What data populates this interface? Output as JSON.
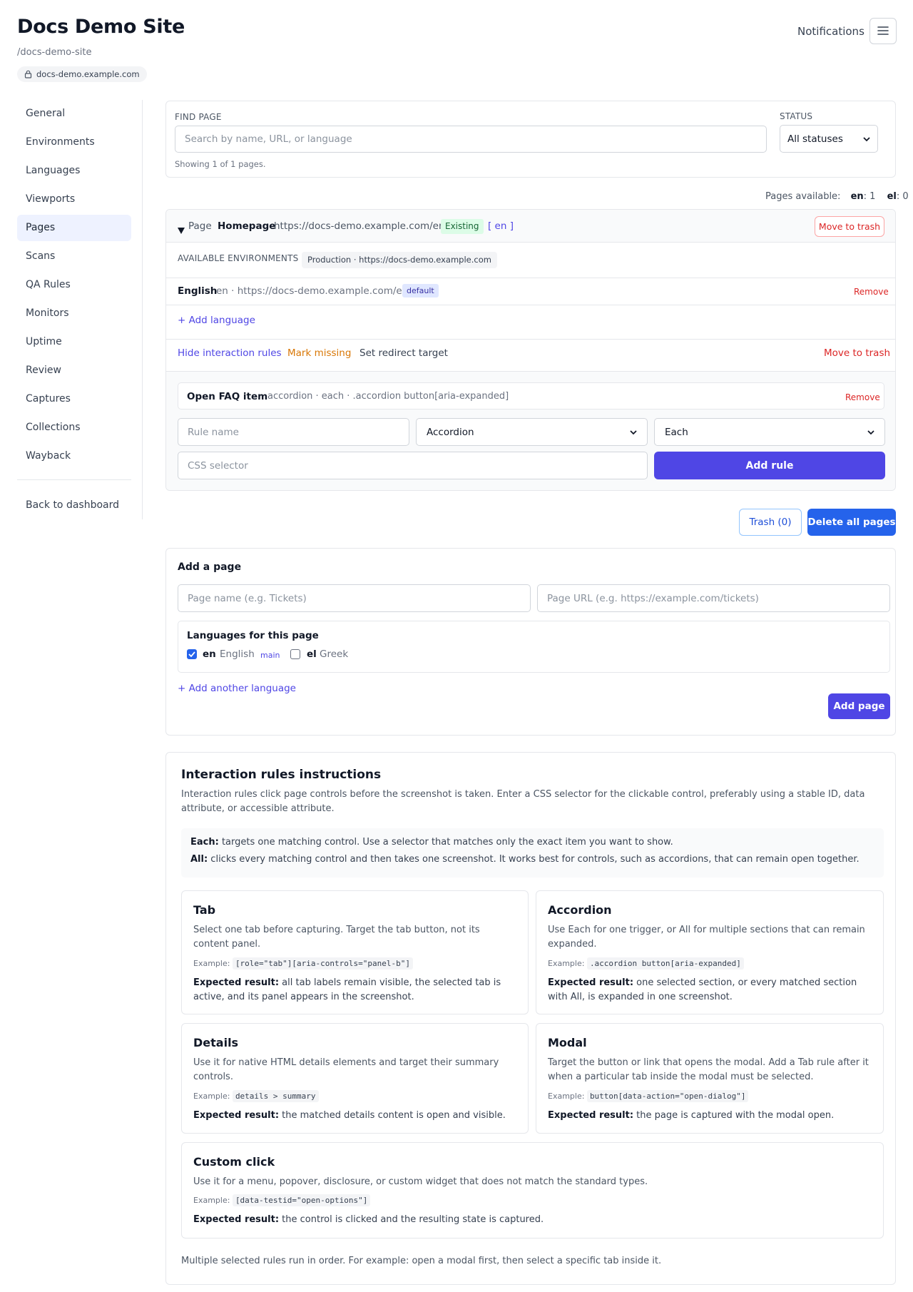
{
  "site": {
    "title": "Docs Demo Site",
    "slug": "/docs-demo-site",
    "domain": "docs-demo.example.com"
  },
  "header": {
    "notifications_label": "Notifications",
    "menu_icon": "hamburger-menu-icon"
  },
  "sidebar": {
    "items": [
      {
        "label": "General"
      },
      {
        "label": "Environments"
      },
      {
        "label": "Languages"
      },
      {
        "label": "Viewports"
      },
      {
        "label": "Pages"
      },
      {
        "label": "Scans"
      },
      {
        "label": "QA Rules"
      },
      {
        "label": "Monitors"
      },
      {
        "label": "Uptime"
      },
      {
        "label": "Review"
      },
      {
        "label": "Captures"
      },
      {
        "label": "Collections"
      },
      {
        "label": "Wayback"
      }
    ],
    "active": "Pages",
    "back_label": "Back to dashboard"
  },
  "filter": {
    "find_label": "FIND PAGE",
    "find_placeholder": "Search by name, URL, or language",
    "status_label": "STATUS",
    "status_value": "All statuses",
    "showing_text": "Showing 1 of 1 pages."
  },
  "availability": {
    "label": "Pages available:",
    "en_code": "en",
    "en_count": ": 1",
    "el_code": "el",
    "el_count": ": 0"
  },
  "page": {
    "toggle_icon": "triangle-down-icon",
    "prefix": "Page",
    "name": "Homepage",
    "url": "https://docs-demo.example.com/en",
    "status_badge": "Existing",
    "lang_tag": "[ en ]",
    "move_to_trash": "Move to trash",
    "available_env_label": "AVAILABLE ENVIRONMENTS",
    "env_chip": "Production · https://docs-demo.example.com",
    "language": {
      "name": "English",
      "meta": "en · https://docs-demo.example.com/en",
      "badge": "default",
      "remove": "Remove"
    },
    "add_language": "+ Add language",
    "actions": {
      "hide_rules": "Hide interaction rules",
      "mark_missing": "Mark missing",
      "set_redirect": "Set redirect target",
      "move_to_trash": "Move to trash"
    },
    "rule": {
      "name": "Open FAQ item",
      "meta": "accordion · each · .accordion button[aria-expanded]",
      "remove": "Remove"
    },
    "rule_form": {
      "name_placeholder": "Rule name",
      "type_value": "Accordion",
      "mode_value": "Each",
      "selector_placeholder": "CSS selector",
      "add_button": "Add rule"
    }
  },
  "bulk": {
    "trash_button": "Trash (0)",
    "delete_all_button": "Delete all pages"
  },
  "add_page": {
    "title": "Add a page",
    "name_placeholder": "Page name (e.g. Tickets)",
    "url_placeholder": "Page URL (e.g. https://example.com/tickets)",
    "languages_title": "Languages for this page",
    "languages": [
      {
        "code": "en",
        "name": "English",
        "badge": "main",
        "checked": true
      },
      {
        "code": "el",
        "name": "Greek",
        "badge": "",
        "checked": false
      }
    ],
    "add_another": "+ Add another language",
    "submit": "Add page"
  },
  "instructions": {
    "title": "Interaction rules instructions",
    "intro": "Interaction rules click page controls before the screenshot is taken. Enter a CSS selector for the clickable control, preferably using a stable ID, data attribute, or accessible attribute.",
    "each_label": "Each:",
    "each_text": " targets one matching control. Use a selector that matches only the exact item you want to show.",
    "all_label": "All:",
    "all_text": " clicks every matching control and then takes one screenshot. It works best for controls, such as accordions, that can remain open together.",
    "example_label": "Example:",
    "expected_label": "Expected result:",
    "cards": [
      {
        "title": "Tab",
        "desc": "Select one tab before capturing. Target the tab button, not its content panel.",
        "example": "[role=\"tab\"][aria-controls=\"panel-b\"]",
        "expected": " all tab labels remain visible, the selected tab is active, and its panel appears in the screenshot."
      },
      {
        "title": "Accordion",
        "desc": "Use Each for one trigger, or All for multiple sections that can remain expanded.",
        "example": ".accordion button[aria-expanded]",
        "expected": " one selected section, or every matched section with All, is expanded in one screenshot."
      },
      {
        "title": "Details",
        "desc": "Use it for native HTML details elements and target their summary controls.",
        "example": "details > summary",
        "expected": " the matched details content is open and visible."
      },
      {
        "title": "Modal",
        "desc": "Target the button or link that opens the modal. Add a Tab rule after it when a particular tab inside the modal must be selected.",
        "example": "button[data-action=\"open-dialog\"]",
        "expected": " the page is captured with the modal open."
      },
      {
        "title": "Custom click",
        "desc": "Use it for a menu, popover, disclosure, or custom widget that does not match the standard types.",
        "example": "[data-testid=\"open-options\"]",
        "expected": " the control is clicked and the resulting state is captured."
      }
    ],
    "footer": "Multiple selected rules run in order. For example: open a modal first, then select a specific tab inside it."
  },
  "colors": {
    "accent": "#4f46e5",
    "primary_blue": "#2563eb",
    "danger": "#dc2626",
    "warning": "#d97706",
    "success_bg": "#dcfce7"
  }
}
